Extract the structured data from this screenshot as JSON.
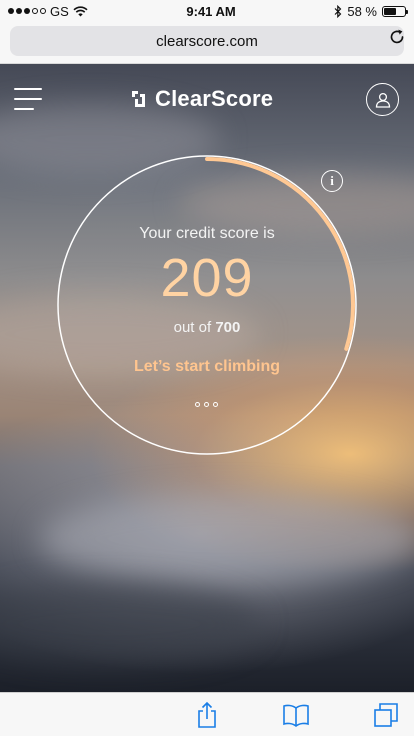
{
  "status_bar": {
    "carrier": "GS",
    "time": "9:41 AM",
    "battery_percent": "58 %",
    "battery_level": 0.58
  },
  "browser": {
    "url": "clearscore.com"
  },
  "app": {
    "brand": "ClearScore"
  },
  "score": {
    "label": "Your credit score is",
    "value": "209",
    "out_of_prefix": "out of",
    "out_of_value": "700",
    "cta": "Let’s start climbing",
    "info_symbol": "i",
    "progress_fraction": 0.2986
  },
  "icons": {
    "menu": "hamburger-menu-icon",
    "profile": "user-icon",
    "info": "info-icon",
    "reload": "reload-icon",
    "share": "share-icon",
    "bookmarks": "bookmarks-icon",
    "tabs": "tabs-icon"
  },
  "colors": {
    "accent": "#ffc58f",
    "score": "#ffd3a3",
    "safari_blue": "#1a7ee6"
  }
}
